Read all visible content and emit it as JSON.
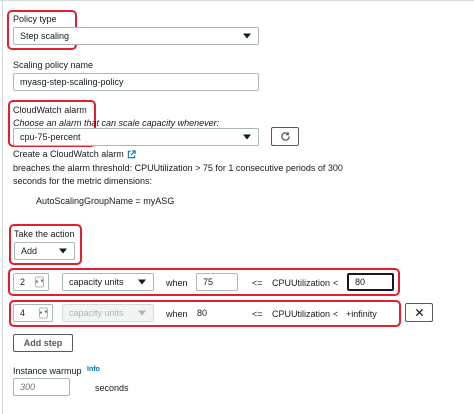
{
  "policy_type": {
    "label": "Policy type",
    "value": "Step scaling"
  },
  "policy_name": {
    "label": "Scaling policy name",
    "value": "myasg-step-scaling-policy"
  },
  "alarm": {
    "label": "CloudWatch alarm",
    "hint": "Choose an alarm that can scale capacity whenever:",
    "value": "cpu-75-percent",
    "create_link": "Create a CloudWatch alarm",
    "description": "breaches the alarm threshold: CPUUtilization > 75 for 1 consecutive periods of 300",
    "description2": "seconds for the metric dimensions:",
    "dimension": "AutoScalingGroupName = myASG"
  },
  "action": {
    "label": "Take the action",
    "value": "Add"
  },
  "steps": [
    {
      "amount": "2",
      "unit": "capacity units",
      "when": "when",
      "lower": "75",
      "op1": "<=",
      "metric": "CPUUtilization",
      "op2": "<",
      "upper": "80"
    },
    {
      "amount": "4",
      "unit": "capacity units",
      "when": "when",
      "lower": "80",
      "op1": "<=",
      "metric": "CPUUtilization",
      "op2": "<",
      "upper": "+infinity"
    }
  ],
  "add_step_label": "Add step",
  "warmup": {
    "label": "Instance warmup",
    "info": "Info",
    "placeholder": "300",
    "unit": "seconds"
  },
  "icons": {
    "refresh": "refresh-icon",
    "external": "external-link-icon",
    "remove": "close-icon"
  },
  "colors": {
    "highlight": "#e0202e",
    "link": "#0073bb"
  }
}
